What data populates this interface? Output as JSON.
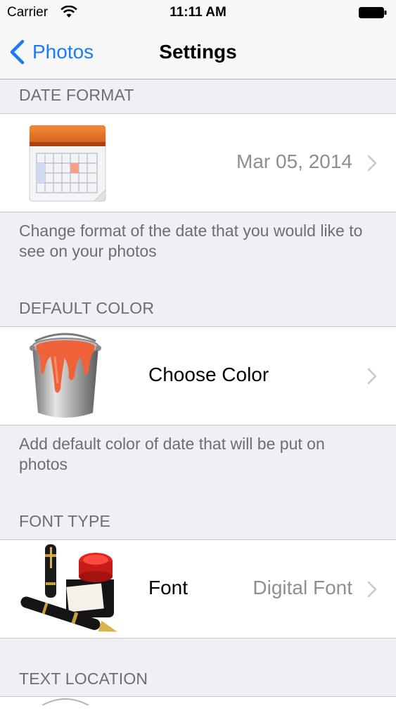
{
  "status_bar": {
    "carrier": "Carrier",
    "time": "11:11 AM"
  },
  "nav": {
    "back_label": "Photos",
    "title": "Settings"
  },
  "sections": {
    "date_format": {
      "header": "DATE FORMAT",
      "value": "Mar 05, 2014",
      "footer": "Change format of the date that you would like to see on your photos",
      "icon": "calendar-icon"
    },
    "default_color": {
      "header": "DEFAULT COLOR",
      "title": "Choose Color",
      "footer": "Add default color of date that will be put on photos",
      "icon": "paint-bucket-icon"
    },
    "font_type": {
      "header": "FONT TYPE",
      "title": "Font",
      "value": "Digital Font",
      "icon": "pen-ink-icon"
    },
    "text_location": {
      "header": "TEXT LOCATION"
    }
  },
  "colors": {
    "accent": "#1a7cf5",
    "background": "#efeff4",
    "paint": "#f0633a"
  }
}
